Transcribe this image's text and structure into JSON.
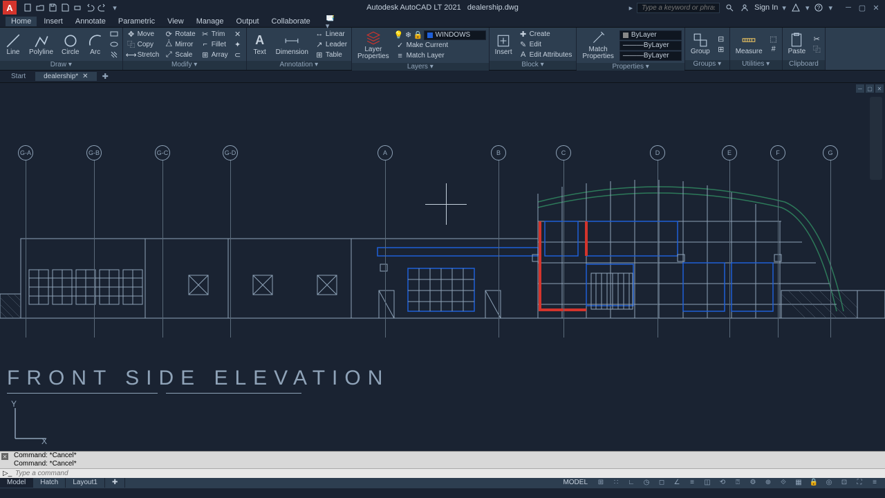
{
  "app": {
    "title": "Autodesk AutoCAD LT 2021",
    "filename": "dealership.dwg"
  },
  "search": {
    "placeholder": "Type a keyword or phrase"
  },
  "signin": "Sign In",
  "menu": [
    "Home",
    "Insert",
    "Annotate",
    "Parametric",
    "View",
    "Manage",
    "Output",
    "Collaborate"
  ],
  "ribbon": {
    "draw": {
      "title": "Draw ▾",
      "tools": [
        "Line",
        "Polyline",
        "Circle",
        "Arc"
      ]
    },
    "modify": {
      "title": "Modify ▾",
      "rows": [
        [
          "Move",
          "Rotate",
          "Trim"
        ],
        [
          "Copy",
          "Mirror",
          "Fillet"
        ],
        [
          "Stretch",
          "Scale",
          "Array"
        ]
      ]
    },
    "annotation": {
      "title": "Annotation ▾",
      "text": "Text",
      "dimension": "Dimension",
      "rows": [
        "Linear",
        "Leader",
        "Table"
      ]
    },
    "layers": {
      "title": "Layers ▾",
      "properties": "Layer\nProperties",
      "current": "WINDOWS",
      "rows": [
        "Make Current",
        "Match Layer"
      ]
    },
    "block": {
      "title": "Block ▾",
      "insert": "Insert",
      "rows": [
        "Create",
        "Edit",
        "Edit Attributes"
      ]
    },
    "properties": {
      "title": "Properties ▾",
      "match": "Match\nProperties",
      "bylayer": "ByLayer"
    },
    "groups": {
      "title": "Groups ▾",
      "group": "Group"
    },
    "utilities": {
      "title": "Utilities ▾",
      "measure": "Measure"
    },
    "clipboard": {
      "title": "Clipboard",
      "paste": "Paste"
    }
  },
  "tabs": {
    "start": "Start",
    "active": "dealership*"
  },
  "grids": [
    "G-A",
    "G-B",
    "G-C",
    "G-D",
    "A",
    "B",
    "C",
    "D",
    "E",
    "F",
    "G"
  ],
  "drawing_title": "FRONT SIDE ELEVATION",
  "ucs": {
    "x": "X",
    "y": "Y"
  },
  "cmd": {
    "history": [
      "Command: *Cancel*",
      "Command: *Cancel*"
    ],
    "placeholder": "Type a command"
  },
  "model_tabs": [
    "Model",
    "Hatch",
    "Layout1"
  ],
  "status": {
    "model": "MODEL"
  }
}
